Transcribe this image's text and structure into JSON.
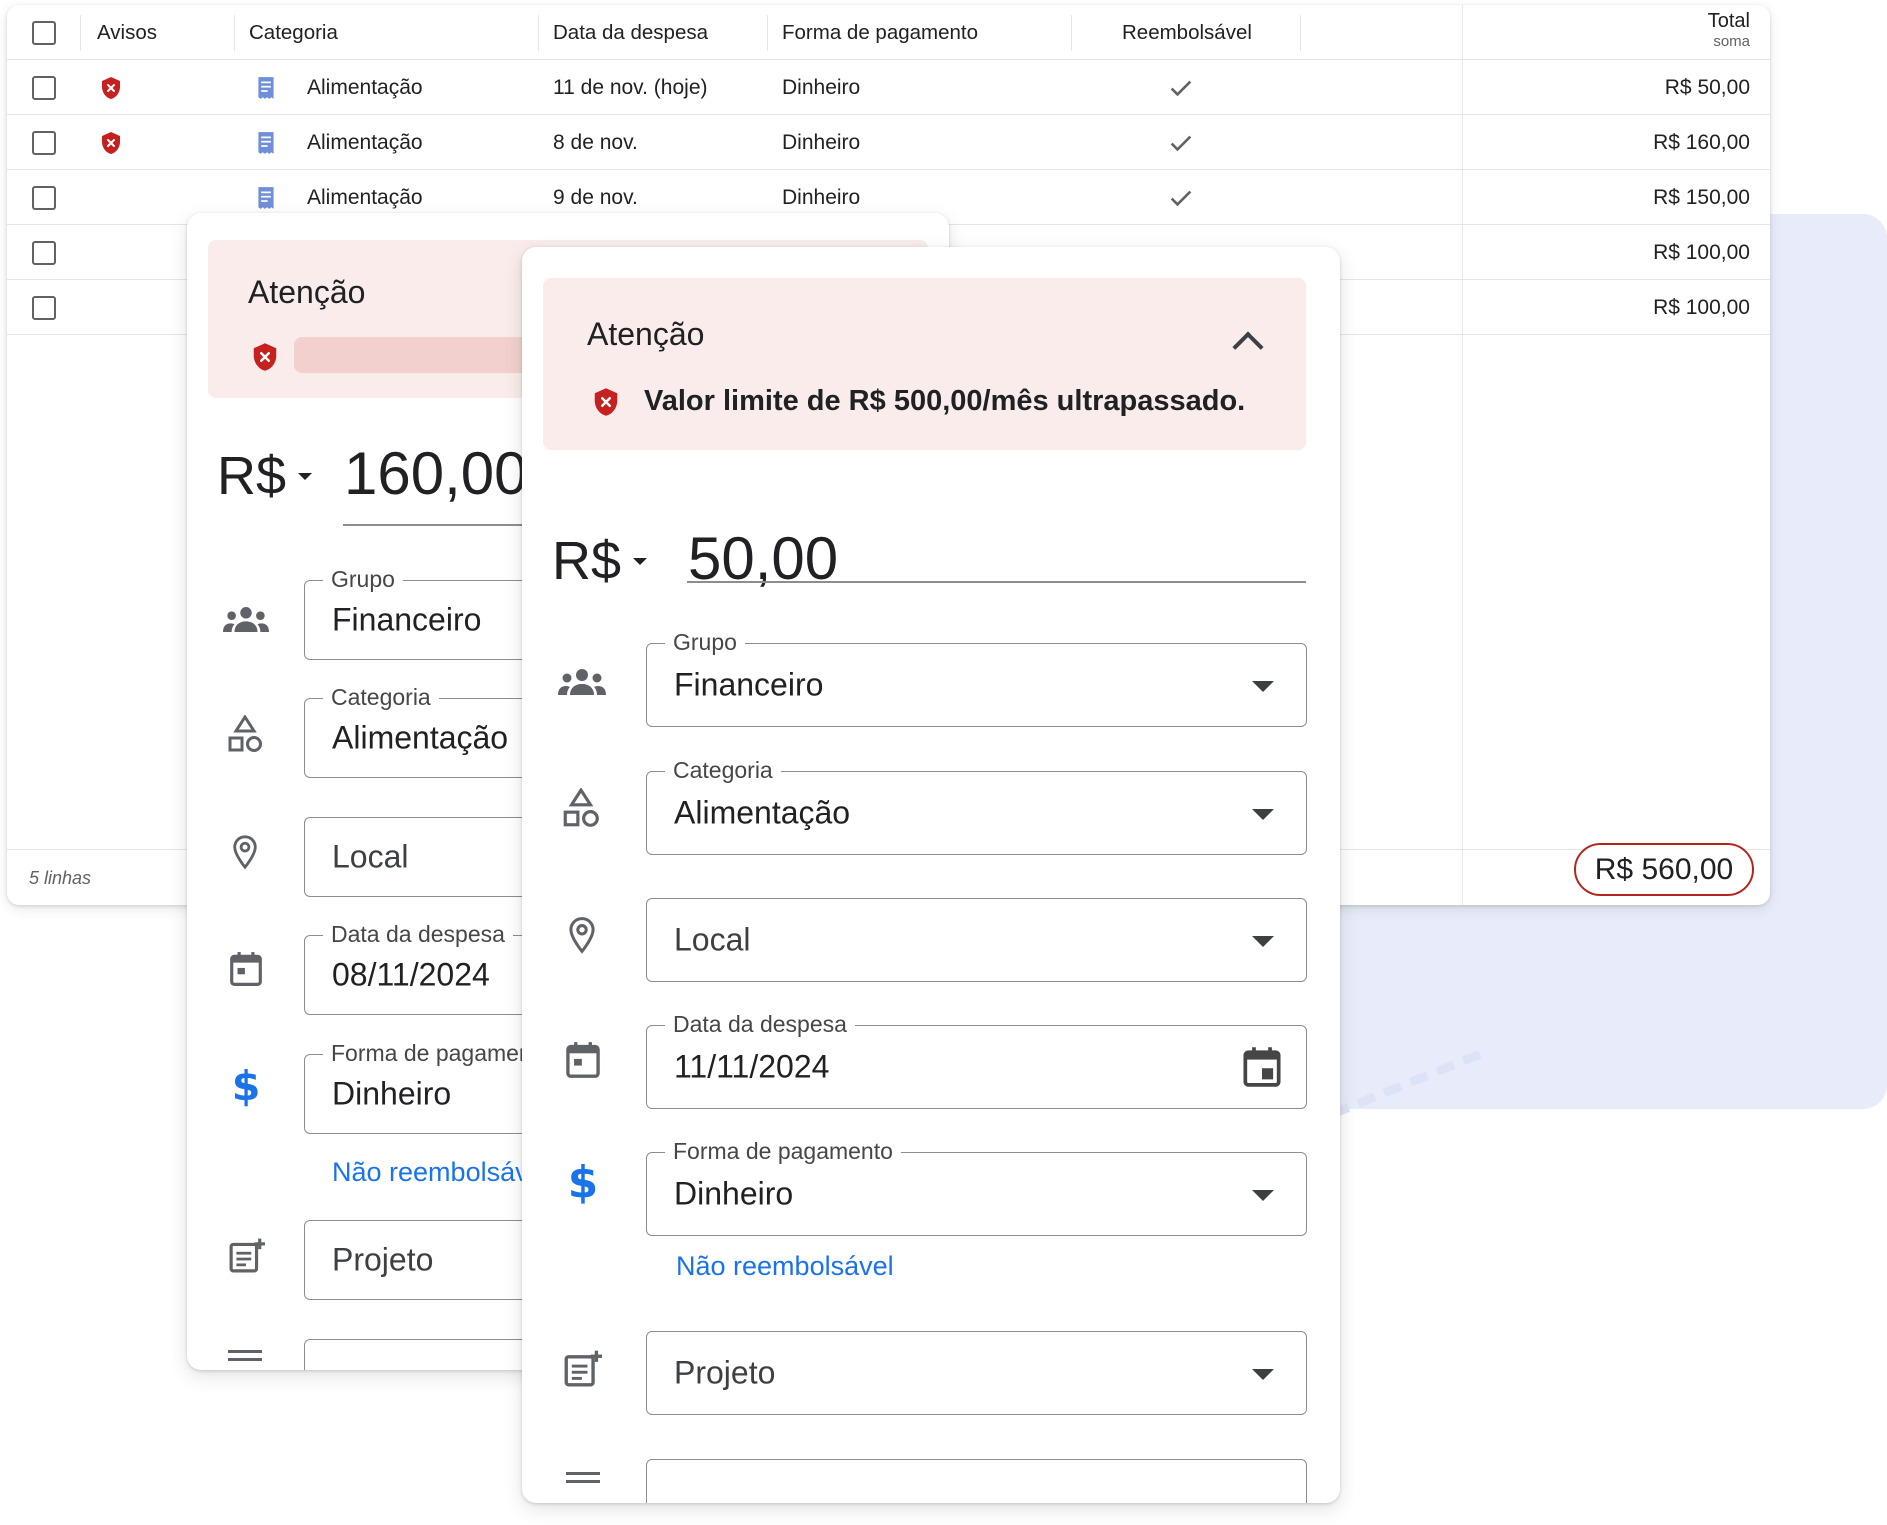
{
  "table": {
    "headers": {
      "avisos": "Avisos",
      "categoria": "Categoria",
      "data": "Data da despesa",
      "forma": "Forma de pagamento",
      "reembolsavel": "Reembolsável",
      "total": "Total",
      "total_sub": "soma"
    },
    "rows": [
      {
        "warning": true,
        "categoria": "Alimentação",
        "data": "11 de nov. (hoje)",
        "forma": "Dinheiro",
        "reembolsavel": true,
        "total": "R$ 50,00"
      },
      {
        "warning": true,
        "categoria": "Alimentação",
        "data": "8 de nov.",
        "forma": "Dinheiro",
        "reembolsavel": true,
        "total": "R$ 160,00"
      },
      {
        "warning": false,
        "categoria": "Alimentação",
        "data": "9 de nov.",
        "forma": "Dinheiro",
        "reembolsavel": true,
        "total": "R$ 150,00"
      },
      {
        "warning": false,
        "categoria": "",
        "data": "",
        "forma": "",
        "reembolsavel": false,
        "total": "R$ 100,00"
      },
      {
        "warning": false,
        "categoria": "",
        "data": "",
        "forma": "",
        "reembolsavel": false,
        "total": "R$ 100,00"
      }
    ],
    "footer_lines": "5 linhas",
    "footer_total": "R$ 560,00"
  },
  "card_back": {
    "alert_title": "Atenção",
    "currency": "R$",
    "amount": "160,00",
    "grupo_label": "Grupo",
    "grupo_value": "Financeiro",
    "categoria_label": "Categoria",
    "categoria_value": "Alimentação",
    "local_placeholder": "Local",
    "data_label": "Data da despesa",
    "data_value": "08/11/2024",
    "forma_label": "Forma de pagamen",
    "forma_value": "Dinheiro",
    "reembolso_link": "Não reembolsáv",
    "projeto_placeholder": "Projeto"
  },
  "card_front": {
    "alert_title": "Atenção",
    "alert_message": "Valor limite de R$ 500,00/mês ultrapassado.",
    "currency": "R$",
    "amount": "50,00",
    "grupo_label": "Grupo",
    "grupo_value": "Financeiro",
    "categoria_label": "Categoria",
    "categoria_value": "Alimentação",
    "local_placeholder": "Local",
    "data_label": "Data da despesa",
    "data_value": "11/11/2024",
    "forma_label": "Forma de pagamento",
    "forma_value": "Dinheiro",
    "reembolso_link": "Não reembolsável",
    "projeto_placeholder": "Projeto"
  },
  "colors": {
    "accent_blue": "#1a73e8",
    "warning_red": "#c5221f",
    "alert_bg": "#f9ecea",
    "decor_bg": "#e8ecfa"
  },
  "icons": [
    "checkbox-icon",
    "shield-error-icon",
    "receipt-icon",
    "check-icon",
    "group-icon",
    "category-shapes-icon",
    "location-pin-icon",
    "calendar-icon",
    "dollar-icon",
    "note-add-icon",
    "notes-icon",
    "chevron-up-icon",
    "dropdown-caret-icon"
  ]
}
